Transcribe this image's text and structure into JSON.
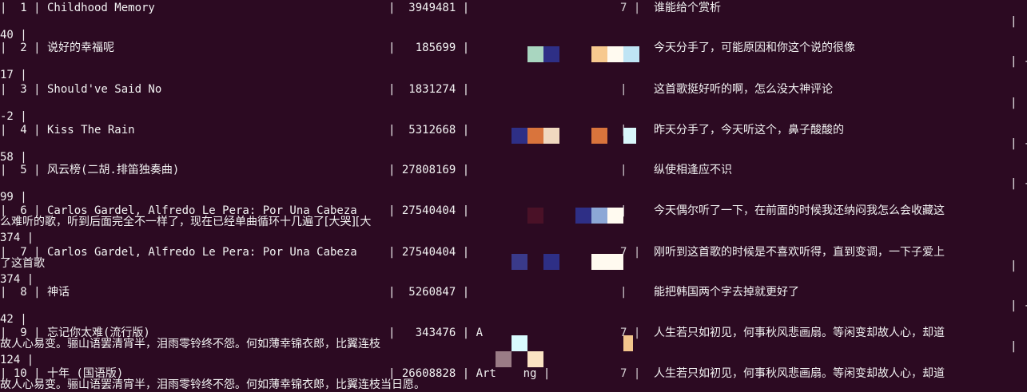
{
  "terminal": {
    "background": "#2c0a22",
    "foreground": "#f2f2f2",
    "rows": [
      {
        "index_cell": "|  1 | Childhood Memory",
        "id_cell": "|  3949481 |",
        "redacted_cell": "7 |",
        "comment": "谁能给个赏析",
        "right_marker": "|",
        "wrap_line": "",
        "tail": "40 |"
      },
      {
        "index_cell": "|  2 | 说好的幸福呢",
        "id_cell": "|   185699 |",
        "redacted_cell": "",
        "comment": "今天分手了，可能原因和你这个说的很像",
        "right_marker": "| -",
        "wrap_line": "",
        "tail": "17 |"
      },
      {
        "index_cell": "|  3 | Should've Said No",
        "id_cell": "|  1831274 |",
        "redacted_cell": "|",
        "comment": "这首歌挺好听的啊，怎么没大神评论",
        "right_marker": "|",
        "wrap_line": "",
        "tail": "-2 |"
      },
      {
        "index_cell": "|  4 | Kiss The Rain",
        "id_cell": "|  5312668 |",
        "redacted_cell": "|",
        "comment": "昨天分手了，今天听这个，鼻子酸酸的",
        "right_marker": "| -",
        "wrap_line": "",
        "tail": "58 |"
      },
      {
        "index_cell": "|  5 | 风云榜(二胡.排笛独奏曲)",
        "id_cell": "| 27808169 |",
        "redacted_cell": "|",
        "comment": "纵使相逢应不识",
        "right_marker": "| -",
        "wrap_line": "",
        "tail": "99 |"
      },
      {
        "index_cell": "|  6 | Carlos Gardel, Alfredo Le Pera: Por Una Cabeza",
        "id_cell": "| 27540404 |",
        "redacted_cell": "|",
        "comment": "今天偶尔听了一下，在前面的时候我还纳闷我怎么会收藏这",
        "right_marker": "",
        "wrap_line": "么难听的歌，听到后面完全不一样了，现在已经单曲循环十几遍了[大哭][大",
        "tail": "374 |"
      },
      {
        "index_cell": "|  7 | Carlos Gardel, Alfredo Le Pera: Por Una Cabeza",
        "id_cell": "| 27540404 |",
        "redacted_cell": "7 |",
        "comment": "刚听到这首歌的时候是不喜欢听得，直到变调，一下子爱上",
        "right_marker": "|",
        "wrap_line": "了这首歌",
        "tail": "374 |"
      },
      {
        "index_cell": "|  8 | 神话",
        "id_cell": "|  5260847 |",
        "redacted_cell": "|",
        "comment": "能把韩国两个字去掉就更好了",
        "right_marker": "| -",
        "wrap_line": "",
        "tail": "42 |"
      },
      {
        "index_cell": "|  9 | 忘记你太难(流行版)",
        "id_cell": "|   343476 | A",
        "redacted_cell": "7 |",
        "comment": "人生若只如初见，何事秋风悲画扇。等闲变却故人心，却道",
        "right_marker": "|",
        "wrap_line": "故人心易变。骊山语罢清宵半，泪雨零铃终不怨。何如薄幸锦衣郎，比翼连枝",
        "tail": "124 |"
      },
      {
        "index_cell": "| 10 | 十年 (国语版)",
        "id_cell": "| 26608828 | Art    ng |",
        "redacted_cell": "7 |",
        "comment": "人生若只如初见，何事秋风悲画扇。等闲变却故人心，却道",
        "right_marker": "",
        "wrap_line": "故人心易变。骊山语罢清宵半，泪雨零铃终不怨。何如薄幸锦衣郎，比翼连枝当日愿。",
        "tail": ""
      }
    ],
    "pixel_blocks": [
      {
        "row": 1,
        "color": "#a9d6c0"
      },
      {
        "row": 1,
        "color": "#2e2f86"
      },
      {
        "row": 1,
        "color": "#f7c98f"
      },
      {
        "row": 1,
        "color": "#fffaf0"
      },
      {
        "row": 1,
        "color": "#bfe4f4"
      },
      {
        "row": 3,
        "color": "#2e2f86"
      },
      {
        "row": 3,
        "color": "#d9743c"
      },
      {
        "row": 3,
        "color": "#f0d8bf"
      },
      {
        "row": 3,
        "color": "#d9743c"
      },
      {
        "row": 3,
        "color": "#d9f7fb"
      },
      {
        "row": 5,
        "color": "#4a1127"
      },
      {
        "row": 5,
        "color": "#2e2f86"
      },
      {
        "row": 5,
        "color": "#8ca7d6"
      },
      {
        "row": 5,
        "color": "#fffaf0"
      },
      {
        "row": 6,
        "color": "#3a3a8a"
      },
      {
        "row": 6,
        "color": "#2e2f86"
      },
      {
        "row": 6,
        "color": "#fffaf0"
      },
      {
        "row": 8,
        "color": "#d9fbff"
      },
      {
        "row": 8,
        "color": "#2e2f86"
      },
      {
        "row": 8,
        "color": "#9a7c86"
      },
      {
        "row": 8,
        "color": "#fbe3c3"
      },
      {
        "row": 8,
        "color": "#f2c58c"
      }
    ]
  }
}
